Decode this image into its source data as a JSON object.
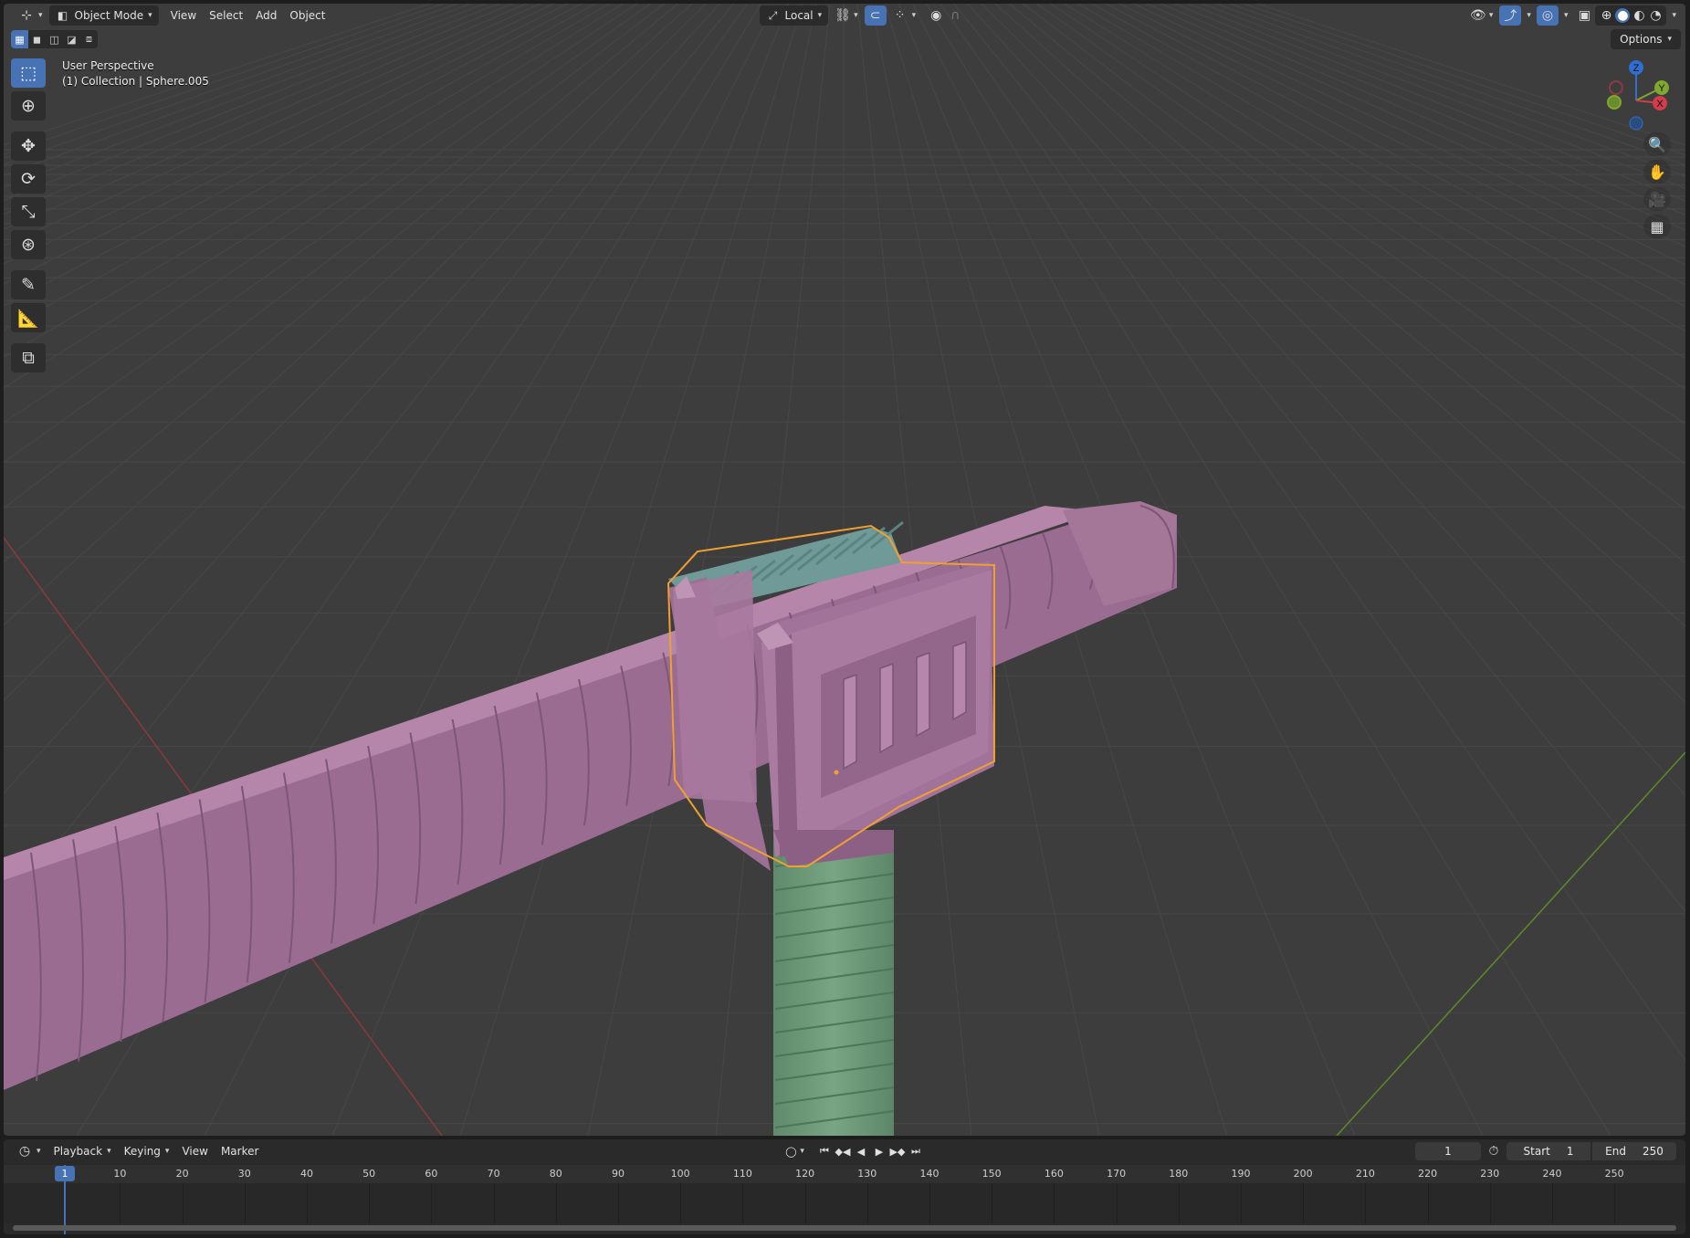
{
  "header": {
    "editor_icon": "3d-viewport-editor-icon",
    "mode": "Object Mode",
    "menus": [
      "View",
      "Select",
      "Add",
      "Object"
    ],
    "orientation": "Local",
    "right_icons": [
      "visibility-icon",
      "gizmo-icon",
      "overlay-icon",
      "xray-icon",
      "wireframe-shading-icon",
      "solid-shading-icon",
      "material-shading-icon",
      "rendered-shading-icon"
    ]
  },
  "select_modes": [
    "set-selection-icon",
    "extend-selection-icon",
    "subtract-selection-icon",
    "invert-selection-icon",
    "intersect-selection-icon"
  ],
  "options_label": "Options",
  "toolbar": [
    "select-box-icon",
    "cursor-icon",
    "move-icon",
    "rotate-icon",
    "scale-icon",
    "transform-icon",
    "annotate-icon",
    "measure-icon",
    "add-cube-icon"
  ],
  "viewport_info": {
    "line1": "User Perspective",
    "line2": "(1) Collection | Sphere.005"
  },
  "gizmo": {
    "x": "X",
    "y": "Y",
    "z": "Z"
  },
  "colors": {
    "viewport_bg": "#3d3d3d",
    "selected_outline": "#f0a030",
    "purple_mesh": "#a2739a",
    "green_mesh": "#6e9a7a",
    "teal_mesh": "#6f9a98",
    "accent": "#4772b3"
  },
  "timeline": {
    "menus": [
      "Playback",
      "Keying",
      "View",
      "Marker"
    ],
    "current_frame": "1",
    "start_label": "Start",
    "start_value": "1",
    "end_label": "End",
    "end_value": "250",
    "ticks": [
      "10",
      "20",
      "30",
      "40",
      "50",
      "60",
      "70",
      "80",
      "90",
      "100",
      "110",
      "120",
      "130",
      "140",
      "150",
      "160",
      "170",
      "180",
      "190",
      "200",
      "210",
      "220",
      "230",
      "240",
      "250"
    ],
    "playhead_frame": "1"
  }
}
